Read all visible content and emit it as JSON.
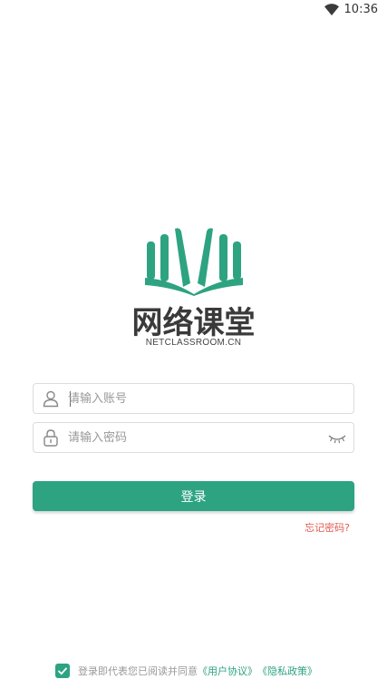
{
  "status_bar": {
    "time": "10:36",
    "wifi_icon": "wifi-icon"
  },
  "logo": {
    "title": "网络课堂",
    "subtitle": "NETCLASSROOM.CN",
    "brand_color": "#2da381"
  },
  "login_form": {
    "account_placeholder": "请输入账号",
    "password_placeholder": "请输入密码",
    "account_icon": "user-icon",
    "password_icon": "lock-icon",
    "toggle_icon": "eye-closed-icon",
    "submit_label": "登录",
    "forgot_label": "忘记密码?"
  },
  "agreement": {
    "checked": true,
    "prefix": "登录即代表您已阅读并同意",
    "user_agreement": "《用户协议》",
    "privacy_policy": "《隐私政策》"
  },
  "colors": {
    "accent": "#2da381",
    "link_red": "#e05a4f",
    "muted_text": "#999999"
  }
}
